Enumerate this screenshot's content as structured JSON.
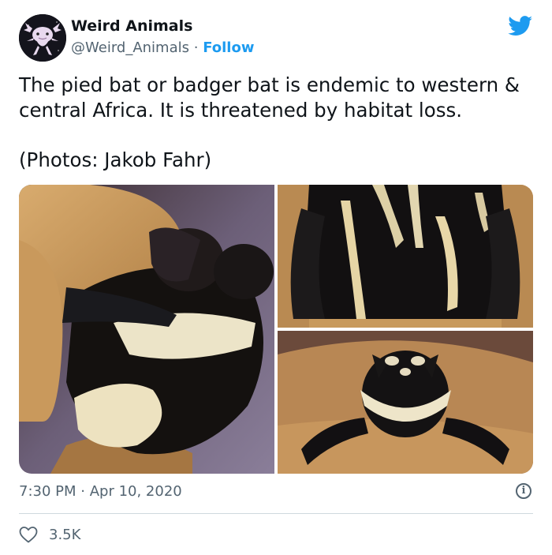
{
  "tweet": {
    "display_name": "Weird Animals",
    "handle": "@Weird_Animals",
    "separator": "·",
    "follow_label": "Follow",
    "text_line1": "The pied bat or badger bat is endemic to western & central Africa. It is threatened by habitat loss.",
    "text_line2": "(Photos: Jakob Fahr)",
    "time": "7:30 PM",
    "date": "Apr 10, 2020",
    "like_count": "3.5K"
  },
  "colors": {
    "accent": "#1d9bf0",
    "text": "#0f1419",
    "secondary": "#536471",
    "divider": "#cfd9de"
  },
  "icons": {
    "brand": "twitter-bird-icon",
    "info": "info-icon",
    "like": "heart-outline-icon"
  }
}
